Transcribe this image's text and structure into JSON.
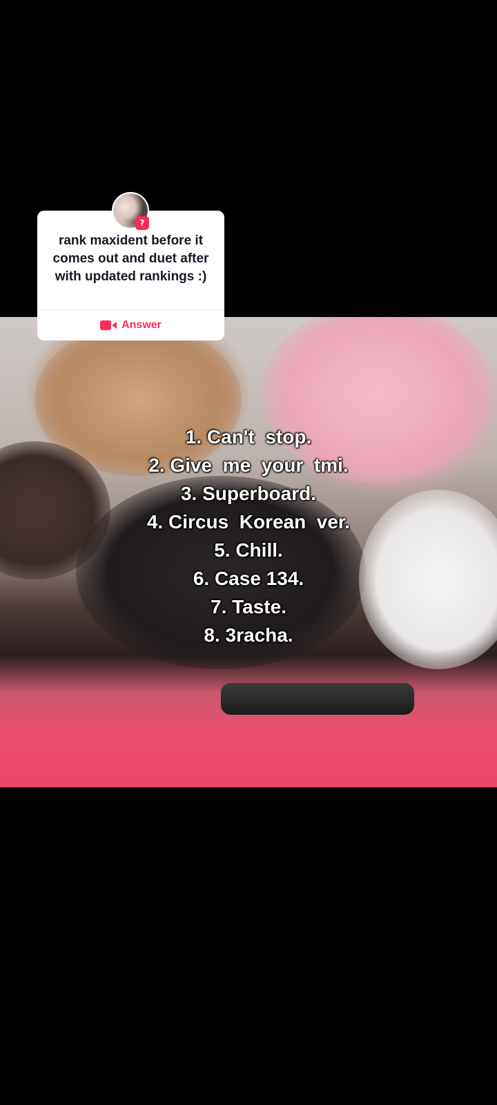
{
  "question_card": {
    "question": "rank maxident before it comes out and duet after with updated rankings :)",
    "answer_label": "Answer",
    "badge_symbol": "?",
    "answer_icon": "video-camera-icon",
    "accent_color": "#fe2c55"
  },
  "video_overlay": {
    "ranking": [
      "1. Can't  stop.",
      "2. Give  me  your  tmi.",
      "3. Superboard.",
      "4. Circus  Korean  ver.",
      "5. Chill.",
      "6. Case 134.",
      "7. Taste.",
      "8. 3racha."
    ]
  }
}
